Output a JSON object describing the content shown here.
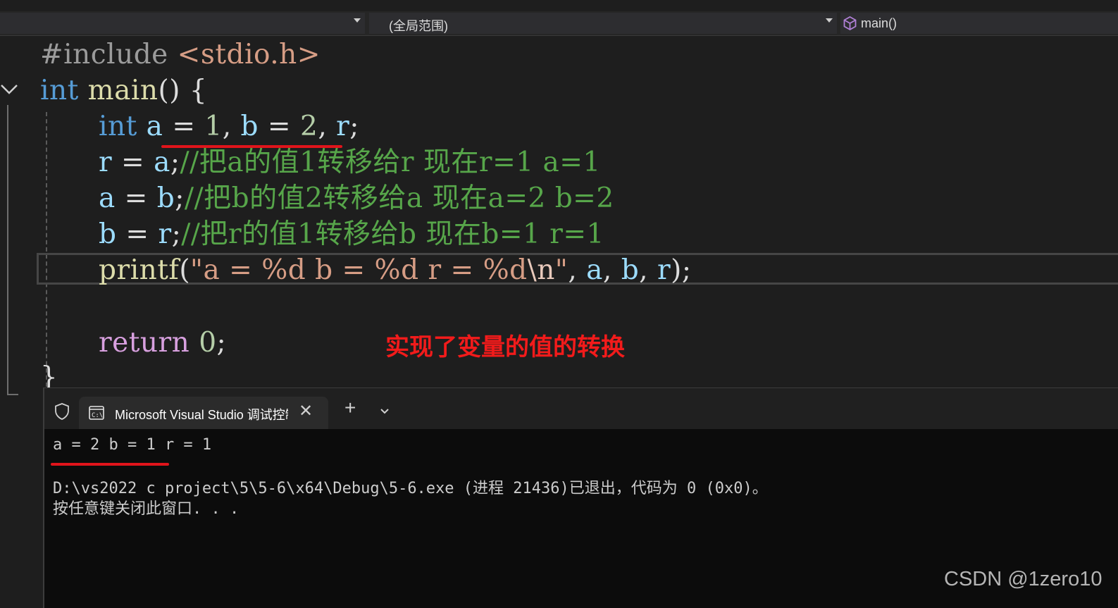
{
  "navbar": {
    "scope_label": "(全局范围)",
    "function_label": "main()"
  },
  "code": {
    "line1": {
      "directive": "#include",
      "header": "<stdio.h>"
    },
    "line2": {
      "type": "int",
      "name": "main",
      "rest": "() {"
    },
    "line3": {
      "type": "int",
      "a": "a",
      "eq1": " = ",
      "v1": "1",
      "sep1": ", ",
      "b": "b",
      "eq2": " = ",
      "v2": "2",
      "sep2": ", ",
      "r": "r",
      "end": ";"
    },
    "line4": {
      "lhs": "r",
      "op": " = ",
      "rhs": "a",
      "semi": ";",
      "comment": "//把a的值1转移给r 现在r=1 a=1"
    },
    "line5": {
      "lhs": "a",
      "op": " = ",
      "rhs": "b",
      "semi": ";",
      "comment": "//把b的值2转移给a 现在a=2 b=2"
    },
    "line6": {
      "lhs": "b",
      "op": " = ",
      "rhs": "r",
      "semi": ";",
      "comment": "//把r的值1转移给b 现在b=1 r=1"
    },
    "line7": {
      "fn": "printf",
      "open": "(",
      "str": "\"a = %d b = %d r = %d",
      "esc": "\\n",
      "strend": "\"",
      "args1": ", ",
      "a": "a",
      "args2": ", ",
      "b": "b",
      "args3": ", ",
      "r": "r",
      "close": ");"
    },
    "line9": {
      "kw": "return",
      "sp": " ",
      "num": "0",
      "semi": ";"
    },
    "line10": {
      "brace": "}"
    }
  },
  "annotation": "实现了变量的值的转换",
  "console": {
    "tab_title": "Microsoft Visual Studio 调试控制台",
    "close_glyph": "✕",
    "add_glyph": "+",
    "output_line": "a = 2 b = 1 r = 1",
    "exit_line": "D:\\vs2022 c project\\5\\5-6\\x64\\Debug\\5-6.exe (进程 21436)已退出，代码为 0 (0x0)。",
    "prompt_line": "按任意键关闭此窗口. . ."
  },
  "watermark": "CSDN @1zero10",
  "icons": {
    "scope_dropdown": "chevron-down-icon",
    "function_icon": "cube-icon",
    "fold": "chevron-down-icon",
    "shield": "shield-icon",
    "cmd": "cmd-icon"
  },
  "colors": {
    "editor_bg": "#1e1e1e",
    "keyword": "#569cd6",
    "function": "#dcdcaa",
    "variable": "#9cdcfe",
    "number": "#b5cea8",
    "string": "#d69d85",
    "comment": "#57a64a",
    "control": "#d8a0df",
    "annotation": "#f21b1b",
    "console_bg": "#0c0c0c"
  }
}
